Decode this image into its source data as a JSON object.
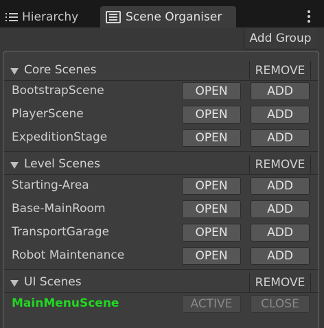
{
  "tabs": [
    {
      "label": "Hierarchy",
      "icon": "hierarchy-list-icon"
    },
    {
      "label": "Scene Organiser",
      "icon": "scene-organiser-icon",
      "selected": true
    }
  ],
  "toolbar": {
    "add_group_label": "Add Group"
  },
  "groups": [
    {
      "title": "Core Scenes",
      "remove_label": "REMOVE",
      "scenes": [
        {
          "name": "BootstrapScene",
          "open_label": "OPEN",
          "add_label": "ADD"
        },
        {
          "name": "PlayerScene",
          "open_label": "OPEN",
          "add_label": "ADD"
        },
        {
          "name": "ExpeditionStage",
          "open_label": "OPEN",
          "add_label": "ADD"
        }
      ]
    },
    {
      "title": "Level Scenes",
      "remove_label": "REMOVE",
      "scenes": [
        {
          "name": "Starting-Area",
          "open_label": "OPEN",
          "add_label": "ADD"
        },
        {
          "name": "Base-MainRoom",
          "open_label": "OPEN",
          "add_label": "ADD"
        },
        {
          "name": "TransportGarage",
          "open_label": "OPEN",
          "add_label": "ADD"
        },
        {
          "name": "Robot Maintenance",
          "open_label": "OPEN",
          "add_label": "ADD"
        }
      ]
    },
    {
      "title": "UI Scenes",
      "remove_label": "REMOVE",
      "scenes": [
        {
          "name": "MainMenuScene",
          "open_label": "ACTIVE",
          "add_label": "CLOSE",
          "active": true
        }
      ]
    }
  ],
  "colors": {
    "active_scene": "#22d622",
    "panel_background": "#3d3d3d",
    "button": "#565656"
  }
}
